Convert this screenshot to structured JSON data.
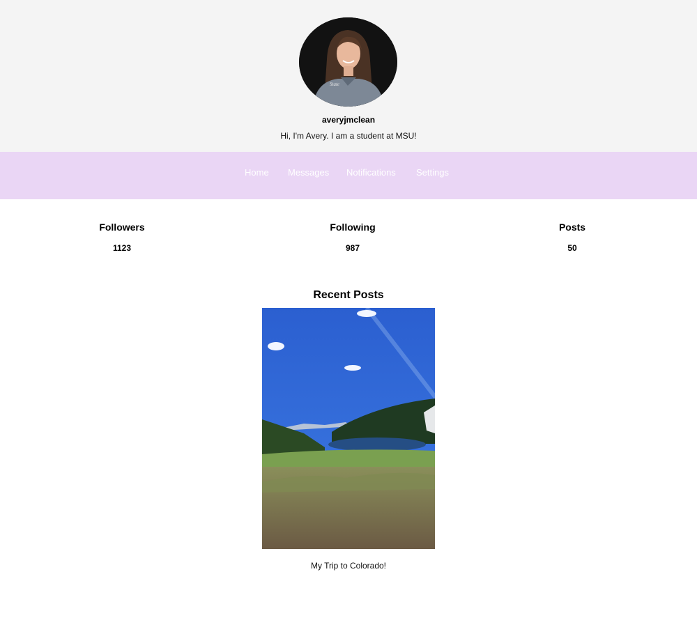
{
  "profile": {
    "username": "averyjmclean",
    "bio": "Hi, I'm Avery. I am a student at MSU!",
    "avatar_icon": "profile-photo"
  },
  "nav": {
    "items": [
      {
        "label": "Home"
      },
      {
        "label": "Messages"
      },
      {
        "label": "Notifications"
      },
      {
        "label": "Settings"
      }
    ]
  },
  "stats": {
    "followers": {
      "label": "Followers",
      "value": "1123"
    },
    "following": {
      "label": "Following",
      "value": "987"
    },
    "posts": {
      "label": "Posts",
      "value": "50"
    }
  },
  "recent_posts": {
    "title": "Recent Posts",
    "items": [
      {
        "caption": "My Trip to Colorado!"
      }
    ]
  },
  "colors": {
    "header_bg": "#f4f4f4",
    "nav_bg": "#ead6f5",
    "nav_text": "#ffffff"
  }
}
